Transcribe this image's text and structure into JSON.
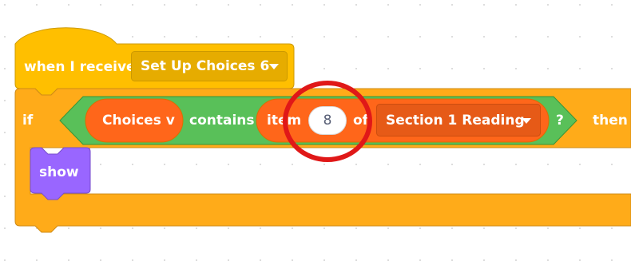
{
  "hat_block": {
    "label": "when I receive",
    "message_value": "Set Up Choices 6"
  },
  "if_block": {
    "if_label": "if",
    "then_label": "then"
  },
  "condition": {
    "list_name": "Choices v",
    "contains_label": "contains",
    "item_label": "item",
    "item_index": "8",
    "of_label": "of",
    "list_dropdown_value": "Section 1 Reading",
    "question_mark": "?"
  },
  "looks_block": {
    "label": "show"
  },
  "colors": {
    "events": "#ffbf00",
    "control": "#ffab19",
    "operators": "#59c059",
    "variables_list": "#ff661a",
    "looks": "#9966ff",
    "annotation": "#e01818"
  }
}
